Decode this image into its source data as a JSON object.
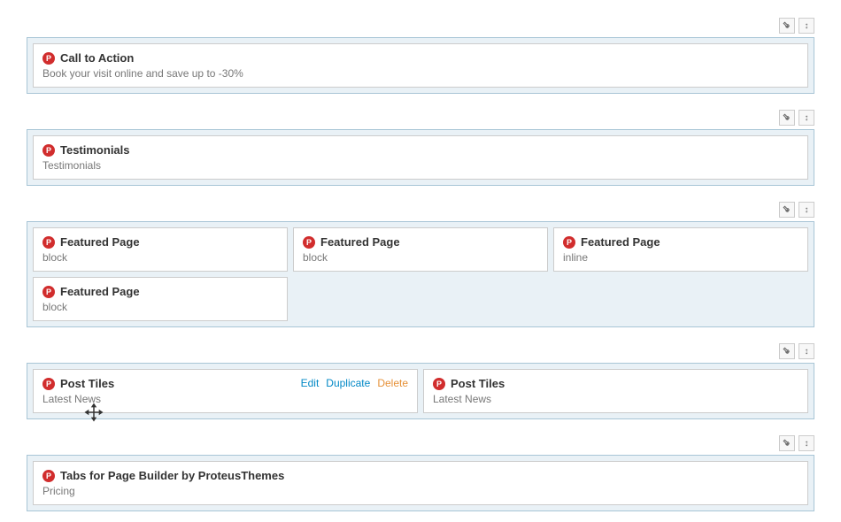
{
  "icon_letter": "P",
  "actions": {
    "edit": "Edit",
    "duplicate": "Duplicate",
    "delete": "Delete"
  },
  "rows": [
    {
      "cols": [
        {
          "widgets": [
            {
              "title": "Call to Action",
              "sub": "Book your visit online and save up to -30%"
            }
          ]
        }
      ]
    },
    {
      "cols": [
        {
          "widgets": [
            {
              "title": "Testimonials",
              "sub": "Testimonials"
            }
          ]
        }
      ]
    },
    {
      "cols": [
        {
          "widgets": [
            {
              "title": "Featured Page",
              "sub": "block"
            },
            {
              "title": "Featured Page",
              "sub": "block"
            }
          ]
        },
        {
          "widgets": [
            {
              "title": "Featured Page",
              "sub": "block"
            }
          ]
        },
        {
          "widgets": [
            {
              "title": "Featured Page",
              "sub": "inline"
            }
          ]
        }
      ]
    },
    {
      "cols": [
        {
          "widgets": [
            {
              "title": "Post Tiles",
              "sub": "Latest News",
              "hover": true
            }
          ]
        },
        {
          "widgets": [
            {
              "title": "Post Tiles",
              "sub": "Latest News"
            }
          ]
        }
      ]
    },
    {
      "cols": [
        {
          "widgets": [
            {
              "title": "Tabs for Page Builder by ProteusThemes",
              "sub": "Pricing"
            }
          ]
        }
      ]
    }
  ]
}
